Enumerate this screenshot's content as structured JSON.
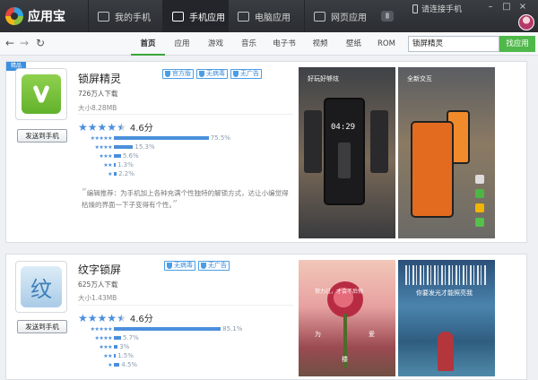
{
  "app": {
    "name": "应用宝"
  },
  "topnav": [
    {
      "label": "我的手机",
      "active": false
    },
    {
      "label": "手机应用",
      "active": true
    },
    {
      "label": "电脑应用",
      "active": false
    },
    {
      "label": "网页应用",
      "active": false
    }
  ],
  "connect_label": "请连接手机",
  "categories": [
    "首页",
    "应用",
    "游戏",
    "音乐",
    "电子书",
    "视频",
    "壁纸",
    "ROM"
  ],
  "active_category": "首页",
  "search": {
    "value": "锁屏精灵",
    "button": "找应用"
  },
  "apps": [
    {
      "ribbon": "精品",
      "name": "锁屏精灵",
      "badges": [
        "官方版",
        "无病毒",
        "无广告"
      ],
      "downloads": "726万人下载",
      "size": "大小8.28MB",
      "rating": 4.6,
      "score_label": "4.6分",
      "send_label": "发送到手机",
      "distribution": [
        {
          "stars": 5,
          "pct": 75.5,
          "label": "75.5%"
        },
        {
          "stars": 4,
          "pct": 15.3,
          "label": "15.3%"
        },
        {
          "stars": 3,
          "pct": 5.6,
          "label": "5.6%"
        },
        {
          "stars": 2,
          "pct": 1.3,
          "label": "1.3%"
        },
        {
          "stars": 1,
          "pct": 2.2,
          "label": "2.2%"
        }
      ],
      "review": "编辑推荐：为手机加上各种充满个性独特的解锁方式，达让小编觉得枯燥的界面一下子变得有个性。",
      "screenshots": [
        {
          "caption": "好玩好够炫",
          "clock": "04:29"
        },
        {
          "caption": "全新交互"
        }
      ]
    },
    {
      "ribbon": "",
      "name": "纹字锁屏",
      "icon_char": "纹",
      "badges": [
        "无病毒",
        "无广告"
      ],
      "downloads": "625万人下载",
      "size": "大小1.43MB",
      "rating": 4.6,
      "score_label": "4.6分",
      "send_label": "发送到手机",
      "distribution": [
        {
          "stars": 5,
          "pct": 85.1,
          "label": "85.1%"
        },
        {
          "stars": 4,
          "pct": 5.7,
          "label": "5.7%"
        },
        {
          "stars": 3,
          "pct": 3.0,
          "label": "3%"
        },
        {
          "stars": 2,
          "pct": 1.5,
          "label": "1.5%"
        },
        {
          "stars": 1,
          "pct": 4.5,
          "label": "4.5%"
        }
      ],
      "screenshots": [
        {
          "caption": "努力过，才会不后悔",
          "words": [
            "为",
            "爱",
            "楼"
          ]
        },
        {
          "caption": "你要发光才能照亮我"
        }
      ]
    }
  ],
  "colors": {
    "accent_green": "#4fb84a",
    "star_blue": "#4a8fdc",
    "topbar": "#2e3034"
  }
}
